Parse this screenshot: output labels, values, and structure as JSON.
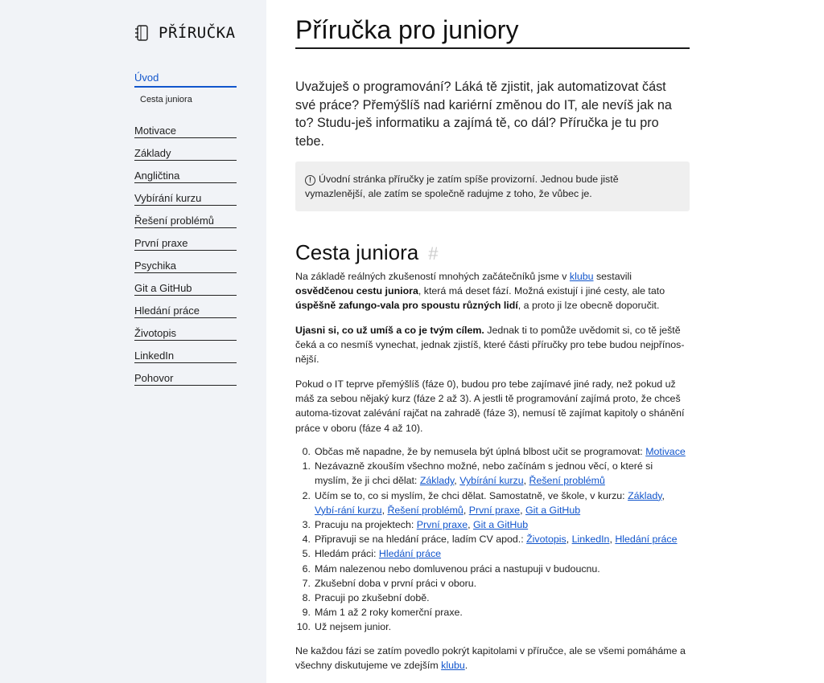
{
  "sidebar": {
    "brand": "PŘÍRUČKA",
    "active_item": "Úvod",
    "sub_item": "Cesta juniora",
    "items": [
      "Motivace",
      "Základy",
      "Angličtina",
      "Vybírání kurzu",
      "Řešení problémů",
      "První praxe",
      "Psychika",
      "Git a GitHub",
      "Hledání práce",
      "Životopis",
      "LinkedIn",
      "Pohovor"
    ]
  },
  "main": {
    "title": "Příručka pro juniory",
    "lead": "Uvažuješ o programování? Láká tě zjistit, jak automatizovat část své práce? Přemýšlíš nad kariérní změnou do IT, ale nevíš jak na to? Studu-ješ informatiku a zajímá tě, co dál? Příručka je tu pro tebe.",
    "callout": "Úvodní stránka příručky je zatím spíše provizorní. Jednou bude jistě vymazlenější, ale zatím se společně radujme z toho, že vůbec je.",
    "section_title": "Cesta juniora",
    "section_anchor": "#",
    "p1": {
      "t1": "Na základě reálných zkušeností mnohých začátečníků jsme v ",
      "link": "klubu",
      "t2": " sestavili ",
      "b1": "osvědčenou cestu juniora",
      "t3": ", která má deset fází. Možná existují i jiné cesty, ale tato ",
      "b2": "úspěšně zafungo-vala pro spoustu různých lidí",
      "t4": ", a proto ji lze obecně doporučit."
    },
    "p2": {
      "b1": "Ujasni si, co už umíš a co je tvým cílem.",
      "t1": " Jednak ti to pomůže uvědomit si, co tě ještě čeká a co nesmíš vynechat, jednak zjistíš, které části příručky pro tebe budou nejpřínos-nější."
    },
    "p3": "Pokud o IT teprve přemýšlíš (fáze 0), budou pro tebe zajímavé jiné rady, než pokud už máš za sebou nějaký kurz (fáze 2 až 3). A jestli tě programování zajímá proto, že chceš automa-tizovat zalévání rajčat na zahradě (fáze 3), nemusí tě zajímat kapitoly o shánění práce v oboru (fáze 4 až 10).",
    "steps": [
      {
        "num": "0.",
        "text": "Občas mě napadne, že by nemusela být úplná blbost učit se programovat: ",
        "links": [
          "Motivace"
        ]
      },
      {
        "num": "1.",
        "text": "Nezávazně zkouším všechno možné, nebo začínám s jednou věcí, o které si myslím, že ji chci dělat: ",
        "links": [
          "Základy",
          "Vybírání kurzu",
          "Řešení problémů"
        ]
      },
      {
        "num": "2.",
        "text": "Učím se to, co si myslím, že chci dělat. Samostatně, ve škole, v kurzu: ",
        "links": [
          "Základy",
          "Vybí-rání kurzu",
          "Řešení problémů",
          "První praxe",
          "Git a GitHub"
        ]
      },
      {
        "num": "3.",
        "text": "Pracuju na projektech: ",
        "links": [
          "První praxe",
          "Git a GitHub"
        ]
      },
      {
        "num": "4.",
        "text": "Připravuji se na hledání práce, ladím CV apod.: ",
        "links": [
          "Životopis",
          "LinkedIn",
          "Hledání práce"
        ]
      },
      {
        "num": "5.",
        "text": "Hledám práci: ",
        "links": [
          "Hledání práce"
        ]
      },
      {
        "num": "6.",
        "text": "Mám nalezenou nebo domluvenou práci a nastupuji v budoucnu.",
        "links": []
      },
      {
        "num": "7.",
        "text": "Zkušební doba v první práci v oboru.",
        "links": []
      },
      {
        "num": "8.",
        "text": "Pracuji po zkušební době.",
        "links": []
      },
      {
        "num": "9.",
        "text": "Mám 1 až 2 roky komerční praxe.",
        "links": []
      },
      {
        "num": "10.",
        "text": "Už nejsem junior.",
        "links": []
      }
    ],
    "p4": {
      "t1": "Ne každou fázi se zatím povedlo pokrýt kapitolami v příručce, ale se všemi pomáháme a všechny diskutujeme ve zdejším ",
      "link": "klubu",
      "t2": "."
    }
  }
}
